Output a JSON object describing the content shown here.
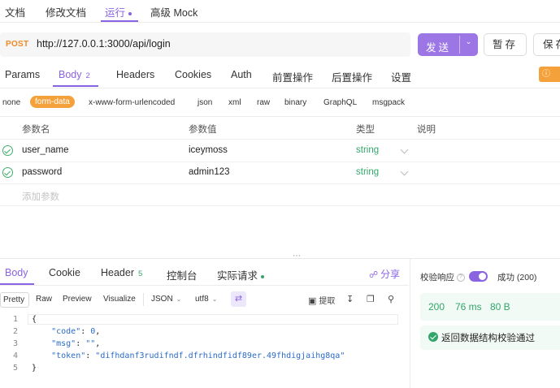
{
  "top_tabs": [
    {
      "label": "文档"
    },
    {
      "label": "修改文档"
    },
    {
      "label": "运行"
    },
    {
      "label": "高级 Mock"
    }
  ],
  "request": {
    "method": "POST",
    "url": "http://127.0.0.1:3000/api/login",
    "send_label": "发送",
    "save_label": "暂存",
    "save_as_label": "保存"
  },
  "request_tabs": [
    {
      "label": "Params"
    },
    {
      "label": "Body",
      "badge": "2"
    },
    {
      "label": "Headers"
    },
    {
      "label": "Cookies"
    },
    {
      "label": "Auth"
    },
    {
      "label": "前置操作"
    },
    {
      "label": "后置操作"
    },
    {
      "label": "设置"
    }
  ],
  "body_types": [
    "none",
    "form-data",
    "x-www-form-urlencoded",
    "json",
    "xml",
    "raw",
    "binary",
    "GraphQL",
    "msgpack"
  ],
  "params_table": {
    "headers": [
      "参数名",
      "参数值",
      "类型",
      "说明"
    ],
    "rows": [
      {
        "name": "user_name",
        "value": "iceymoss",
        "type": "string",
        "desc": ""
      },
      {
        "name": "password",
        "value": "admin123",
        "type": "string",
        "desc": ""
      }
    ],
    "add_placeholder": "添加参数"
  },
  "response_tabs": [
    {
      "label": "Body"
    },
    {
      "label": "Cookie"
    },
    {
      "label": "Header",
      "badge": "5"
    },
    {
      "label": "控制台"
    },
    {
      "label": "实际请求"
    }
  ],
  "share_label": "分享",
  "response_toolbar": {
    "views": [
      "Pretty",
      "Raw",
      "Preview",
      "Visualize"
    ],
    "format": "JSON",
    "encoding": "utf8",
    "extract_label": "提取"
  },
  "response_body": {
    "line_numbers": [
      "1",
      "2",
      "3",
      "4",
      "5"
    ],
    "fields": [
      {
        "key": "\"code\"",
        "value": "0"
      },
      {
        "key": "\"msg\"",
        "value": "\"\""
      },
      {
        "key": "\"token\"",
        "value": "\"difhdanf3rudifndf.dfrhindfidf89er.49fhdigjaihg8qa\""
      }
    ]
  },
  "validation": {
    "label": "校验响应",
    "status": "成功 (200)",
    "status_code": "200",
    "time": "76 ms",
    "size": "80 B",
    "result": "返回数据结构校验通过"
  },
  "colors": {
    "accent": "#8a63e0",
    "method": "#f08a24",
    "success": "#33a56a",
    "badge_orange": "#f5a13b"
  }
}
